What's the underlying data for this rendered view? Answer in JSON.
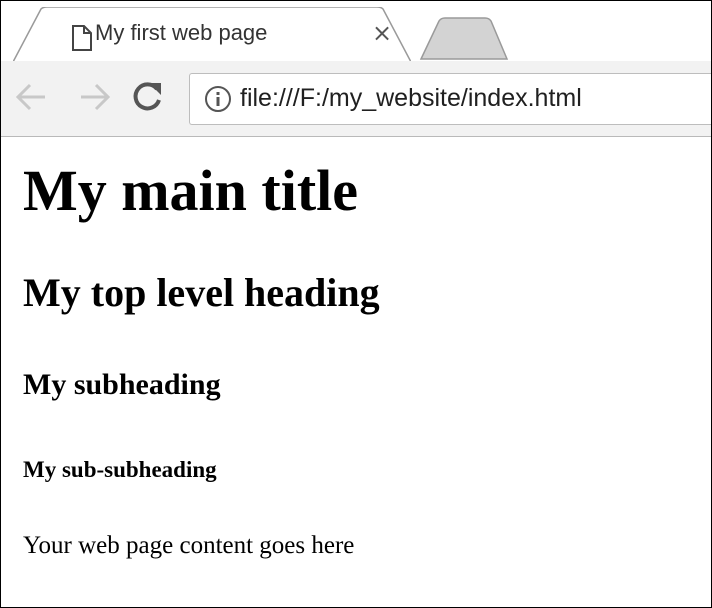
{
  "browser": {
    "tab": {
      "title": "My first web page",
      "close_glyph": "×",
      "icon": "page-icon"
    },
    "toolbar": {
      "back_icon": "arrow-left-icon",
      "forward_icon": "arrow-right-icon",
      "reload_icon": "reload-icon",
      "info_icon": "info-icon",
      "url": "file:///F:/my_website/index.html"
    },
    "colors": {
      "toolbar_bg": "#f2f2f2",
      "tab_border": "#9a9a9a",
      "new_tab_fill": "#d3d3d3"
    }
  },
  "page": {
    "h1": "My main title",
    "h2": "My top level heading",
    "h3": "My subheading",
    "h4": "My sub-subheading",
    "paragraph": "Your web page content goes here"
  }
}
